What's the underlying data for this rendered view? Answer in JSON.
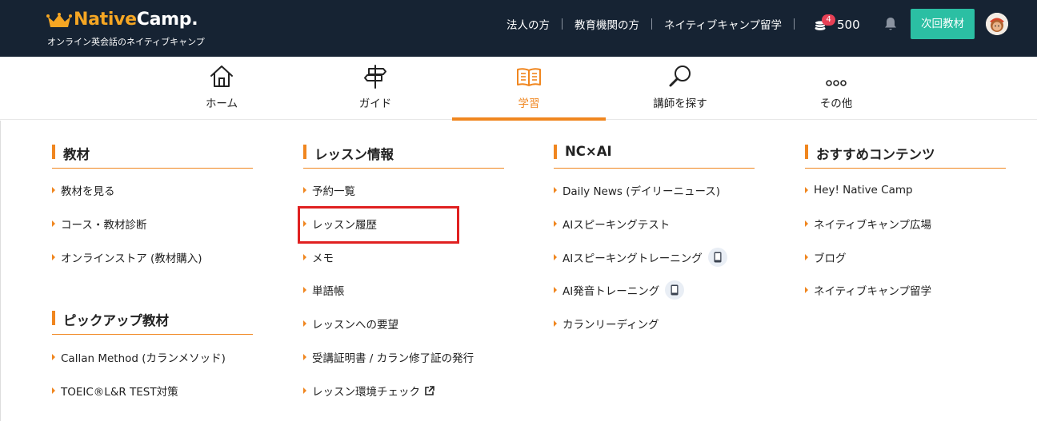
{
  "header": {
    "logo": {
      "brand_native": "Native",
      "brand_camp": "Camp.",
      "tagline": "オンライン英会話のネイティブキャンプ"
    },
    "links": [
      "法人の方",
      "教育機関の方",
      "ネイティブキャンプ留学"
    ],
    "coins": {
      "badge": "4",
      "count": "500"
    },
    "next_button": "次回教材"
  },
  "nav": {
    "items": [
      {
        "label": "ホーム",
        "icon": "home-icon"
      },
      {
        "label": "ガイド",
        "icon": "signpost-icon"
      },
      {
        "label": "学習",
        "icon": "book-icon",
        "active": true
      },
      {
        "label": "講師を探す",
        "icon": "search-icon"
      },
      {
        "label": "その他",
        "icon": "more-icon"
      }
    ]
  },
  "menu": {
    "materials": {
      "title": "教材",
      "items": [
        "教材を見る",
        "コース・教材診断",
        "オンラインストア (教材購入)"
      ]
    },
    "pickup": {
      "title": "ピックアップ教材",
      "items": [
        "Callan Method (カランメソッド)",
        "TOEIC®L&R TEST対策"
      ]
    },
    "lesson_info": {
      "title": "レッスン情報",
      "items": [
        "予約一覧",
        "レッスン履歴",
        "メモ",
        "単語帳",
        "レッスンへの要望",
        "受講証明書 / カラン修了証の発行",
        "レッスン環境チェック"
      ]
    },
    "nc_ai": {
      "title": "NC×AI",
      "items": [
        "Daily News (デイリーニュース)",
        "AIスピーキングテスト",
        "AIスピーキングトレーニング",
        "AI発音トレーニング",
        "カランリーディング"
      ]
    },
    "recommended": {
      "title": "おすすめコンテンツ",
      "items": [
        "Hey! Native Camp",
        "ネイティブキャンプ広場",
        "ブログ",
        "ネイティブキャンプ留学"
      ]
    }
  },
  "colors": {
    "header_bg": "#162333",
    "accent": "#f0861f",
    "cta": "#2bbfa3",
    "highlight": "#e02020",
    "logo_orange": "#f5a623"
  }
}
